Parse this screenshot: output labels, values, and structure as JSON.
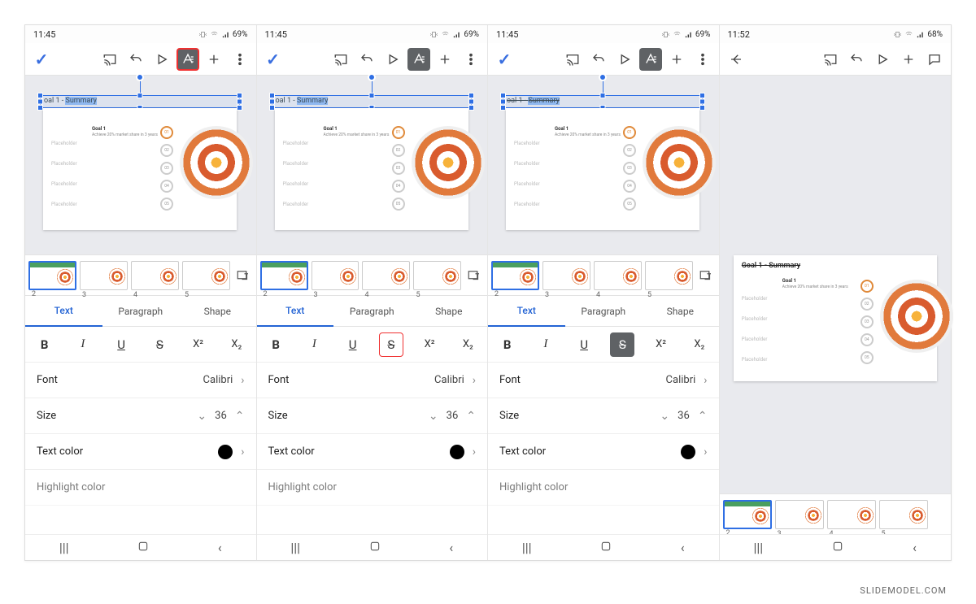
{
  "watermark": "SLIDEMODEL.COM",
  "status": {
    "time1": "11:45",
    "time2": "11:52",
    "battery1": "69%",
    "battery2": "68%"
  },
  "slide": {
    "title_prefix": "oal 1 - ",
    "title_highlight": "Summary",
    "full_title": "Goal 1 - Summary",
    "goal_label": "Goal 1",
    "goal_desc": "Achieve 20% market share in 3 years",
    "placeholders": [
      "Placeholder",
      "Placeholder",
      "Placeholder",
      "Placeholder"
    ],
    "circles": [
      "01",
      "02",
      "03",
      "04",
      "05"
    ]
  },
  "thumbs": {
    "nums": [
      "2",
      "3",
      "4",
      "5"
    ]
  },
  "panel": {
    "tabs": {
      "text": "Text",
      "paragraph": "Paragraph",
      "shape": "Shape"
    },
    "buttons": {
      "b": "B",
      "i": "I",
      "u": "U",
      "s": "S",
      "sup": "X²",
      "sub": "X₂"
    },
    "font_label": "Font",
    "font_value": "Calibri",
    "size_label": "Size",
    "size_value": "36",
    "textcolor_label": "Text color",
    "highlight_label": "Highlight color"
  }
}
